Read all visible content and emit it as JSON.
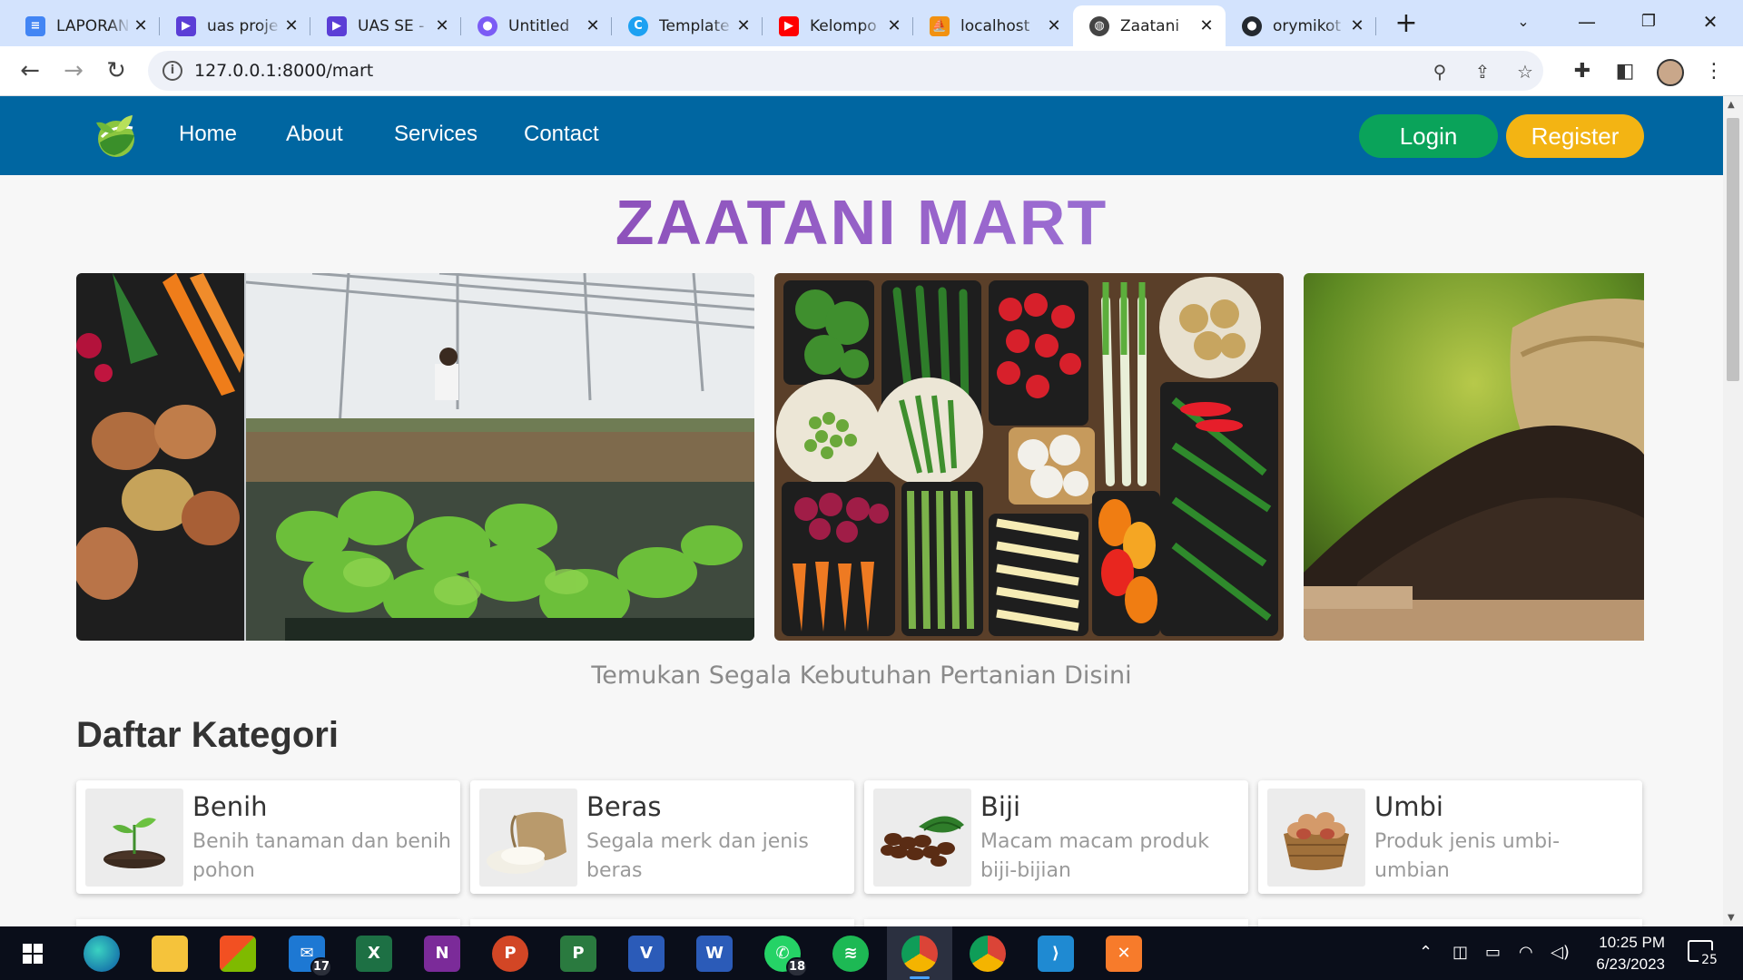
{
  "browser": {
    "tabs": [
      {
        "title": "LAPORAN",
        "icon": "docs-icon",
        "color": "#4285f4"
      },
      {
        "title": "uas proje",
        "icon": "video-icon",
        "color": "#5b3ed6"
      },
      {
        "title": "UAS SE -",
        "icon": "video-icon",
        "color": "#5b3ed6"
      },
      {
        "title": "Untitled",
        "icon": "app-icon",
        "color": "#7b5cf5"
      },
      {
        "title": "Template",
        "icon": "canva-icon",
        "color": "#1da1f2"
      },
      {
        "title": "Kelompo",
        "icon": "youtube-icon",
        "color": "#ff0000"
      },
      {
        "title": "localhost",
        "icon": "phpmyadmin-icon",
        "color": "#f29111"
      },
      {
        "title": "Zaatani",
        "icon": "globe-icon",
        "color": "#444444"
      },
      {
        "title": "orymikot",
        "icon": "github-icon",
        "color": "#24292f"
      }
    ],
    "active_tab_index": 7,
    "close_glyph": "✕",
    "new_tab_glyph": "+",
    "url": "127.0.0.1:8000/mart",
    "info_glyph": "i"
  },
  "site": {
    "nav": {
      "links": [
        "Home",
        "About",
        "Services",
        "Contact"
      ],
      "login_label": "Login",
      "register_label": "Register"
    },
    "hero_title": "ZAATANI MART",
    "tagline": "Temukan Segala Kebutuhan Pertanian Disini",
    "categories_title": "Daftar Kategori",
    "categories": [
      {
        "name": "Benih",
        "desc": "Benih tanaman dan benih pohon",
        "icon": "seedling-icon"
      },
      {
        "name": "Beras",
        "desc": "Segala merk dan jenis beras",
        "icon": "rice-sack-icon"
      },
      {
        "name": "Biji",
        "desc": "Macam macam produk biji-bijian",
        "icon": "coffee-beans-icon"
      },
      {
        "name": "Umbi",
        "desc": "Produk jenis umbi-umbian",
        "icon": "potato-basket-icon"
      }
    ],
    "colors": {
      "nav_bg": "#0066a1",
      "login": "#0aa35a",
      "register": "#f3b413"
    }
  },
  "taskbar": {
    "apps": [
      {
        "name": "Start",
        "icon": "windows-icon"
      },
      {
        "name": "Edge",
        "icon": "edge-icon"
      },
      {
        "name": "File Explorer",
        "icon": "folder-icon"
      },
      {
        "name": "Microsoft Store",
        "icon": "store-icon"
      },
      {
        "name": "Mail",
        "icon": "mail-icon",
        "badge": "17"
      },
      {
        "name": "Excel",
        "icon": "excel-icon"
      },
      {
        "name": "OneNote",
        "icon": "onenote-icon"
      },
      {
        "name": "PowerPoint",
        "icon": "powerpoint-icon"
      },
      {
        "name": "Project",
        "icon": "project-icon"
      },
      {
        "name": "Visio",
        "icon": "visio-icon"
      },
      {
        "name": "Word",
        "icon": "word-icon"
      },
      {
        "name": "WhatsApp",
        "icon": "whatsapp-icon",
        "badge": "18"
      },
      {
        "name": "Spotify",
        "icon": "spotify-icon"
      },
      {
        "name": "Chrome",
        "icon": "chrome-icon"
      },
      {
        "name": "Chrome",
        "icon": "chrome-icon"
      },
      {
        "name": "VS Code",
        "icon": "vscode-icon"
      },
      {
        "name": "XAMPP",
        "icon": "xampp-icon"
      }
    ],
    "time": "10:25 PM",
    "date": "6/23/2023",
    "notifications": "25"
  }
}
